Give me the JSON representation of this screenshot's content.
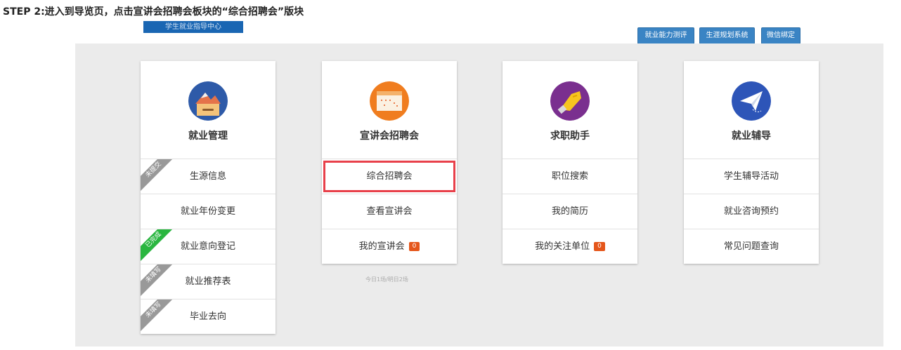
{
  "step_title": "STEP 2:进入到导览页，点击宣讲会招聘会板块的“综合招聘会”版块",
  "logo_text": "学生就业指导中心",
  "top_buttons": [
    "就业能力测评",
    "生涯规划系统",
    "微信绑定"
  ],
  "colors": {
    "accent": "#3a84c4",
    "highlight": "#e8404a",
    "badge": "#e5561b",
    "ribbon_gray": "#999999",
    "ribbon_green": "#2ab640"
  },
  "cards": [
    {
      "title": "就业管理",
      "icon": "landscape-icon",
      "rows": [
        {
          "label": "生源信息",
          "ribbon": "未提交"
        },
        {
          "label": "就业年份变更"
        },
        {
          "label": "就业意向登记",
          "ribbon": "已完成"
        },
        {
          "label": "就业推荐表",
          "ribbon": "未填写"
        },
        {
          "label": "毕业去向",
          "ribbon": "未填写"
        }
      ]
    },
    {
      "title": "宣讲会招聘会",
      "icon": "calendar-icon",
      "rows": [
        {
          "label": "综合招聘会",
          "highlighted": true
        },
        {
          "label": "查看宣讲会"
        },
        {
          "label": "我的宣讲会",
          "badge": "0"
        }
      ],
      "note": "今日1场/明日2场"
    },
    {
      "title": "求职助手",
      "icon": "handshake-icon",
      "rows": [
        {
          "label": "职位搜索"
        },
        {
          "label": "我的简历"
        },
        {
          "label": "我的关注单位",
          "badge": "0"
        }
      ]
    },
    {
      "title": "就业辅导",
      "icon": "paper-plane-icon",
      "rows": [
        {
          "label": "学生辅导活动"
        },
        {
          "label": "就业咨询预约"
        },
        {
          "label": "常见问题查询"
        }
      ]
    }
  ]
}
